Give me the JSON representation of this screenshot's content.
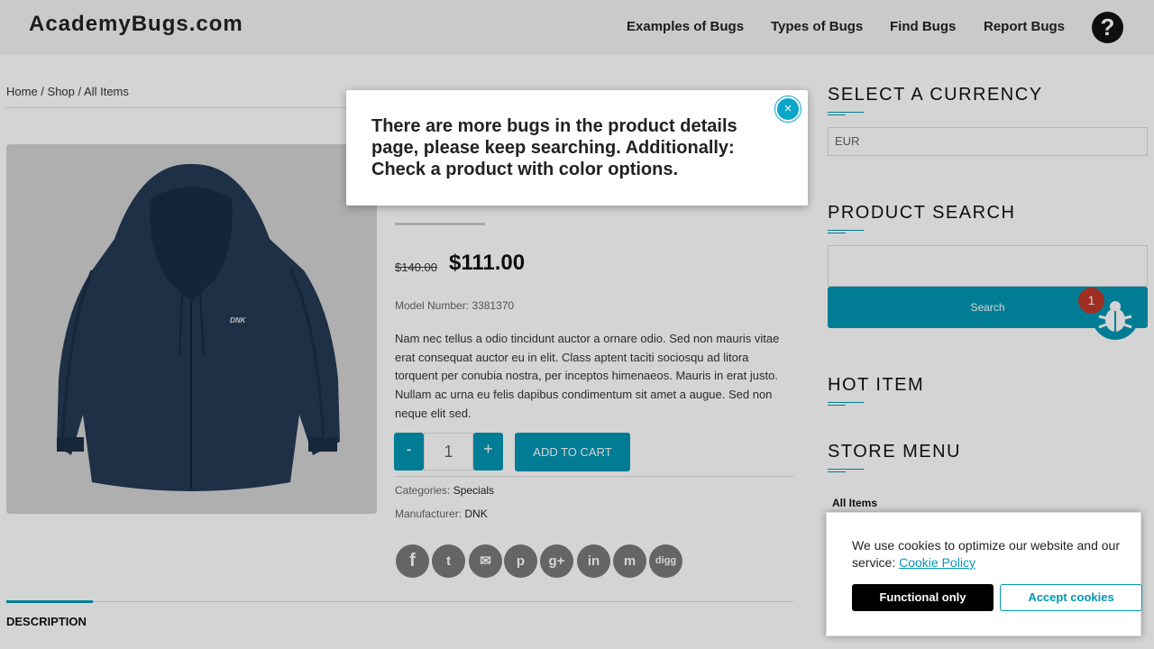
{
  "header": {
    "logo": "AcademyBugs.com",
    "nav": [
      "Examples of Bugs",
      "Types of Bugs",
      "Find Bugs",
      "Report Bugs"
    ],
    "help_icon": "question-circle-icon",
    "help_label": "?"
  },
  "breadcrumb": {
    "home": "Home",
    "sep1": " / ",
    "shop": "Shop",
    "sep2": " / ",
    "current": "All Items"
  },
  "product": {
    "old_price": "$140.00",
    "new_price": "$111.00",
    "model": "Model Number: 3381370",
    "description": "Nam nec tellus a odio tincidunt auctor a ornare odio. Sed non mauris vitae erat consequat auctor eu in elit. Class aptent taciti sociosqu ad litora torquent per conubia nostra, per inceptos himenaeos. Mauris in erat justo. Nullam ac urna eu felis dapibus condimentum sit amet a augue. Sed non neque elit sed.",
    "qty_minus": "-",
    "qty_value": "1",
    "qty_plus": "+",
    "add_to_cart": "ADD TO CART",
    "categories_label": "Categories: ",
    "categories_value": "Specials",
    "manufacturer_label": "Manufacturer: ",
    "manufacturer_value": "DNK",
    "image_brand": "DNK"
  },
  "social": [
    {
      "icon": "facebook-icon",
      "glyph": "f"
    },
    {
      "icon": "twitter-icon",
      "glyph": "t"
    },
    {
      "icon": "email-icon",
      "glyph": "✉"
    },
    {
      "icon": "pinterest-icon",
      "glyph": "p"
    },
    {
      "icon": "google-plus-icon",
      "glyph": "g+"
    },
    {
      "icon": "linkedin-icon",
      "glyph": "in"
    },
    {
      "icon": "myspace-icon",
      "glyph": "m"
    },
    {
      "icon": "digg-icon",
      "glyph": "digg"
    }
  ],
  "tabs": {
    "description": "DESCRIPTION"
  },
  "sidebar": {
    "currency_title": "SELECT A CURRENCY",
    "currency_value": "EUR",
    "search_title": "PRODUCT SEARCH",
    "search_button": "Search",
    "hot_item_title": "HOT ITEM",
    "store_menu_title": "STORE MENU",
    "store_items": [
      "All Items"
    ]
  },
  "bug_widget": {
    "icon": "bug-icon",
    "badge": "1"
  },
  "modal": {
    "text": "There are more bugs in the product details page, please keep searching. Additionally: Check a product with color options.",
    "close_glyph": "×"
  },
  "cookie": {
    "text": "We use cookies to optimize our website and our service:",
    "policy_link": "Cookie Policy",
    "functional_button": "Functional only",
    "accept_button": "Accept cookies"
  },
  "colors": {
    "accent": "#0097b3",
    "badge": "#c0392b"
  }
}
